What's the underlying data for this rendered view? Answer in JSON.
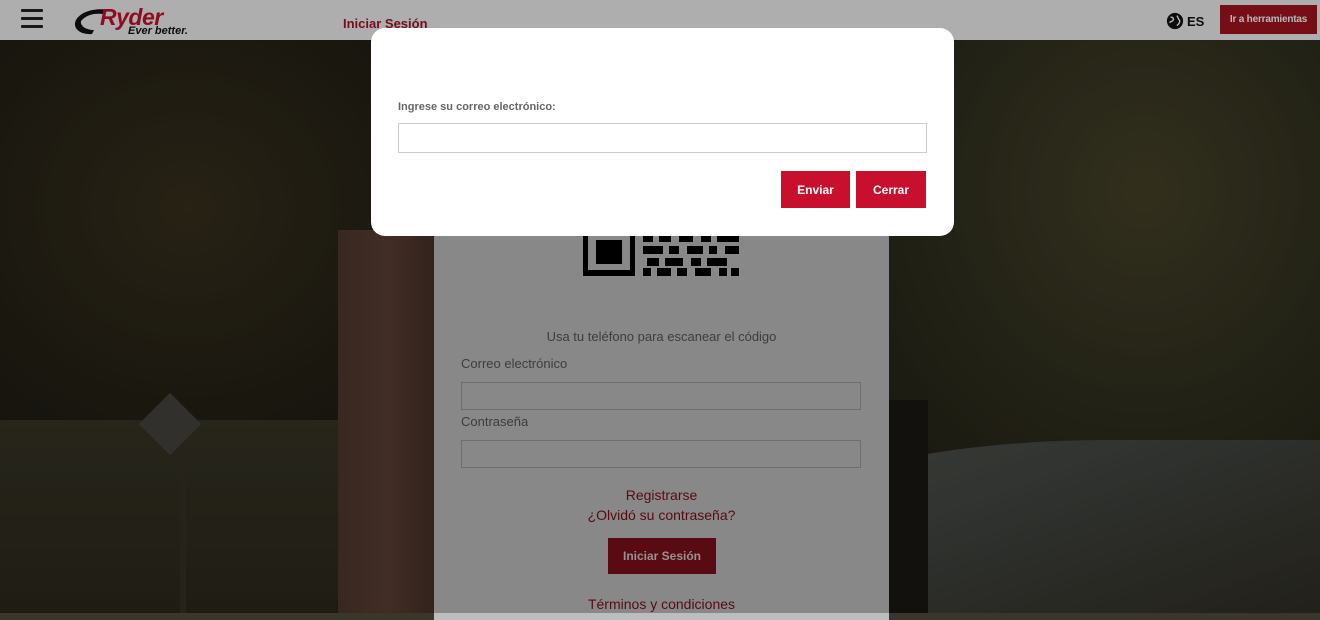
{
  "header": {
    "logo_word": "Ryder",
    "logo_tagline": "Ever better.",
    "nav_login": "Iniciar Sesión",
    "language": "ES",
    "tools_button": "Ir a herramientas"
  },
  "login": {
    "qr_caption": "Usa tu teléfono para escanear el código",
    "email_label": "Correo electrónico",
    "password_label": "Contraseña",
    "register_link": "Registrarse",
    "forgot_link": "¿Olvidó su contraseña?",
    "submit_button": "Iniciar Sesión",
    "terms_link": "Términos y condiciones"
  },
  "modal": {
    "label": "Ingrese su correo electrónico:",
    "email_value": "",
    "send_button": "Enviar",
    "close_button": "Cerrar"
  },
  "colors": {
    "brand_red": "#c8102e",
    "dark_red": "#a3141f"
  }
}
